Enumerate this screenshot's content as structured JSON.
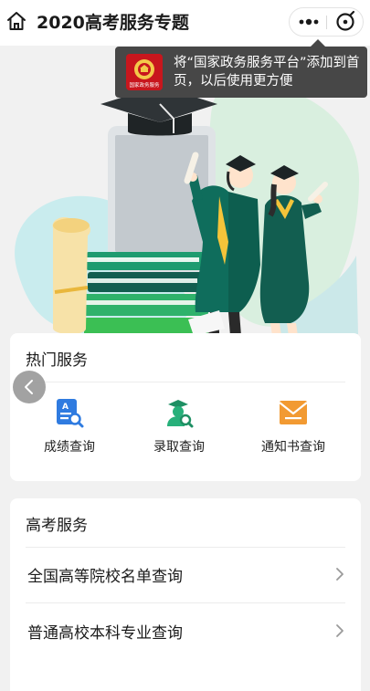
{
  "header": {
    "title": "2020高考服务专题",
    "home_icon": "home-icon",
    "more_icon": "more-dots-icon",
    "close_icon": "close-circle-icon"
  },
  "tooltip": {
    "text": "将“国家政务服务平台”添加到首页，以后使用更方便",
    "logo_icon": "gov-service-platform-logo",
    "logo_caption": "国家政务服务"
  },
  "hot_services": {
    "title": "热门服务",
    "items": [
      {
        "label": "成绩查询",
        "icon": "score-search-icon",
        "color": "#2f7be0"
      },
      {
        "label": "录取查询",
        "icon": "admission-search-icon",
        "color": "#27b07a"
      },
      {
        "label": "通知书查询",
        "icon": "notice-envelope-icon",
        "color": "#f29a32"
      }
    ]
  },
  "gaokao_services": {
    "title": "高考服务",
    "items": [
      {
        "label": "全国高等院校名单查询"
      },
      {
        "label": "普通高校本科专业查询"
      }
    ]
  },
  "colors": {
    "accent_green": "#27b07a",
    "gown_green": "#0f6d5c",
    "tooltip_bg": "#474747"
  }
}
